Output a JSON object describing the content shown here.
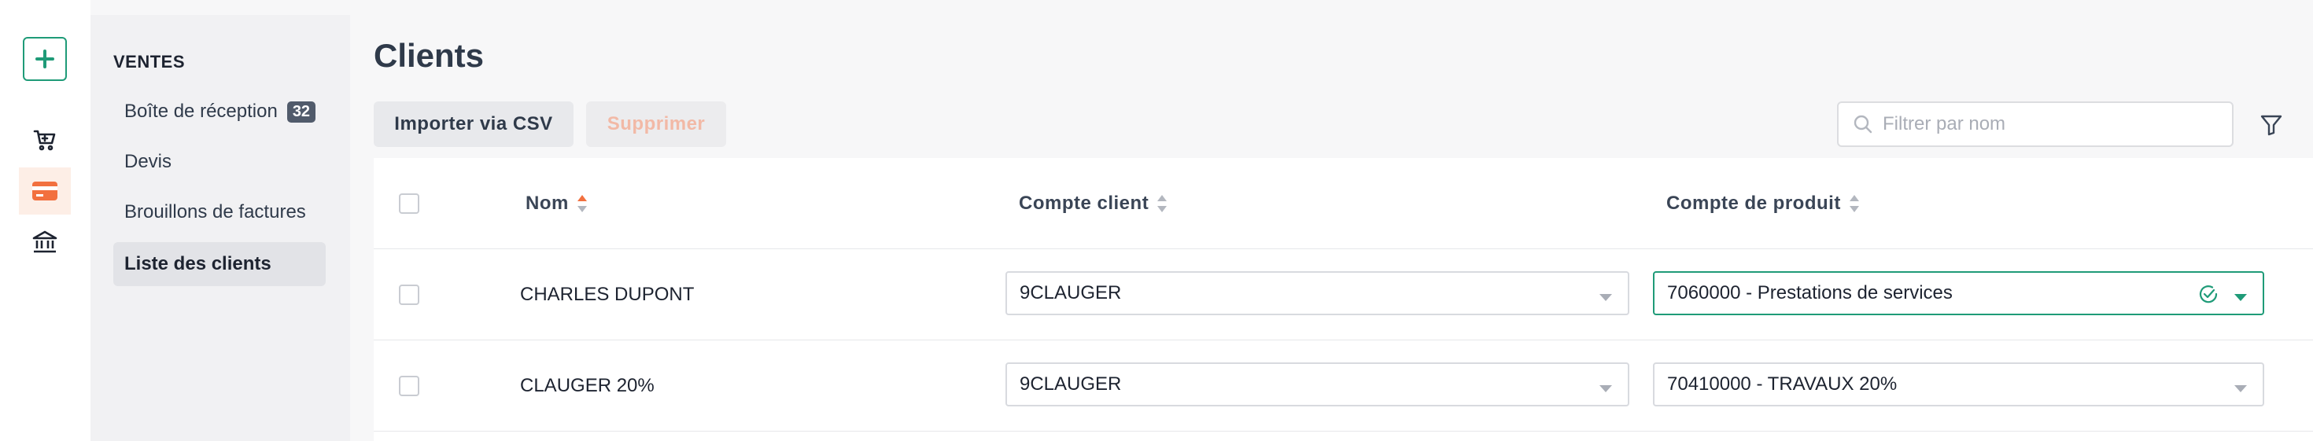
{
  "rail": {
    "icons": [
      "plus-icon",
      "cart-icon",
      "card-icon",
      "bank-icon"
    ]
  },
  "sidebar": {
    "section": "VENTES",
    "items": [
      {
        "label": "Boîte de réception",
        "badge": "32"
      },
      {
        "label": "Devis"
      },
      {
        "label": "Brouillons de factures"
      },
      {
        "label": "Liste des clients",
        "active": true
      }
    ]
  },
  "main": {
    "title": "Clients",
    "import_label": "Importer via CSV",
    "delete_label": "Supprimer",
    "search_placeholder": "Filtrer par nom"
  },
  "table": {
    "columns": [
      "Nom",
      "Compte client",
      "Compte de produit"
    ],
    "rows": [
      {
        "name": "CHARLES DUPONT",
        "client_account": "9CLAUGER",
        "product_account": "7060000 - Prestations de services"
      },
      {
        "name": "CLAUGER 20%",
        "client_account": "9CLAUGER",
        "product_account": "70410000 - TRAVAUX 20%"
      }
    ]
  },
  "colors": {
    "accent_green": "#1f9b78",
    "accent_orange": "#f2703f",
    "sort_active": "#f2703f"
  }
}
